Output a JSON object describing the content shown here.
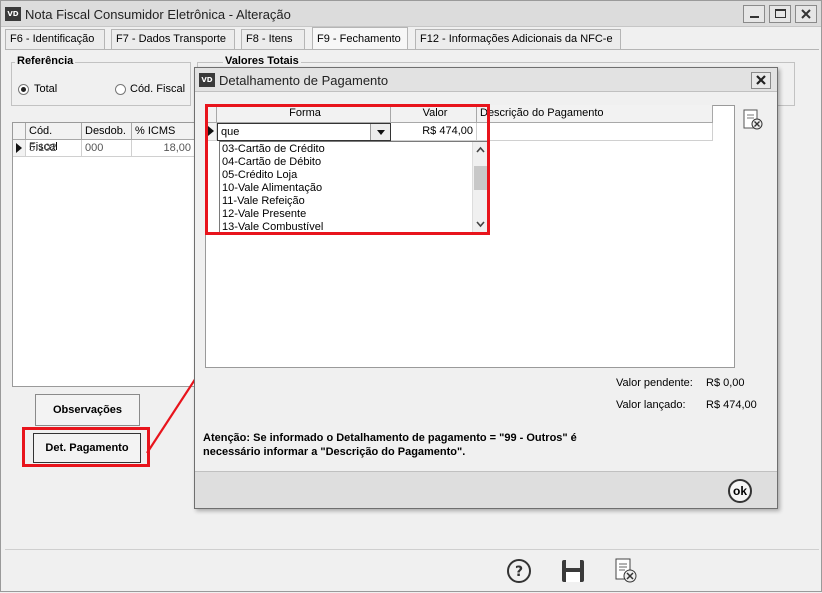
{
  "window": {
    "title": "Nota Fiscal Consumidor Eletrônica - Alteração",
    "app_icon": "VD"
  },
  "tabs": [
    {
      "label": "F6 - Identificação"
    },
    {
      "label": "F7 - Dados Transporte"
    },
    {
      "label": "F8 - Itens"
    },
    {
      "label": "F9 - Fechamento",
      "active": true
    },
    {
      "label": "F12 - Informações Adicionais da NFC-e"
    }
  ],
  "referencia": {
    "title": "Referência",
    "options": [
      "Total",
      "Cód. Fiscal"
    ],
    "selected": "Total"
  },
  "valores_totais": {
    "title": "Valores Totais"
  },
  "fiscal_grid": {
    "headers": [
      "Cód. Fiscal",
      "Desdob.",
      "% ICMS"
    ],
    "rows": [
      [
        "5.102",
        "000",
        "18,00"
      ]
    ]
  },
  "buttons": {
    "observacoes": "Observações",
    "det_pagamento": "Det. Pagamento"
  },
  "dialog": {
    "title": "Detalhamento de Pagamento",
    "app_icon": "VD",
    "headers": [
      "Forma",
      "Valor",
      "Descrição do Pagamento"
    ],
    "row": {
      "forma": "que",
      "valor": "R$ 474,00"
    },
    "dropdown_options": [
      "03-Cartão de Crédito",
      "04-Cartão de Débito",
      "05-Crédito Loja",
      "10-Vale Alimentação",
      "11-Vale Refeição",
      "12-Vale Presente",
      "13-Vale Combustível"
    ],
    "valor_pendente_label": "Valor pendente:",
    "valor_pendente": "R$ 0,00",
    "valor_lancado_label": "Valor lançado:",
    "valor_lancado": "R$ 474,00",
    "warning_line1": "Atenção: Se informado o Detalhamento de pagamento = \"99 - Outros\" é",
    "warning_line2": "necessário informar a \"Descrição do Pagamento\".",
    "ok_label": "ok"
  },
  "colors": {
    "highlight": "#e8141c"
  },
  "icons": [
    "help-icon",
    "save-icon",
    "cancel-document-icon",
    "delete-row-icon",
    "ok-icon",
    "dropdown-arrow-icon",
    "row-pointer-icon"
  ]
}
